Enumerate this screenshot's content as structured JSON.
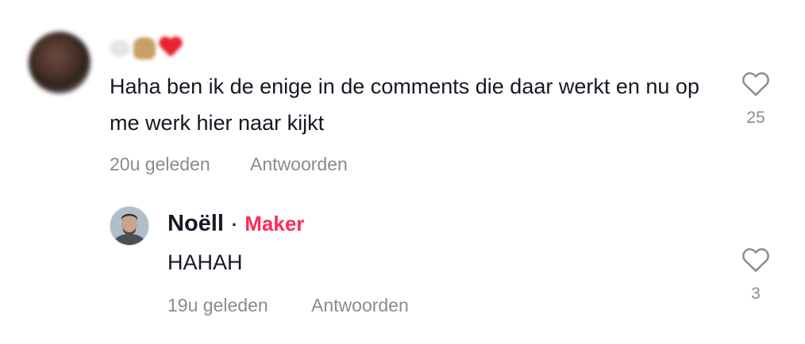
{
  "comment": {
    "text": "Haha ben ik de enige in de comments die daar werkt en nu op me werk hier naar kijkt",
    "time": "20u geleden",
    "reply_label": "Antwoorden",
    "like_count": "25"
  },
  "reply": {
    "author": "Noëll",
    "separator": "·",
    "badge": "Maker",
    "text": "HAHAH",
    "time": "19u geleden",
    "reply_label": "Antwoorden",
    "like_count": "3"
  },
  "colors": {
    "badge": "#fe2c55",
    "meta": "#8a8b91",
    "text": "#161823"
  }
}
